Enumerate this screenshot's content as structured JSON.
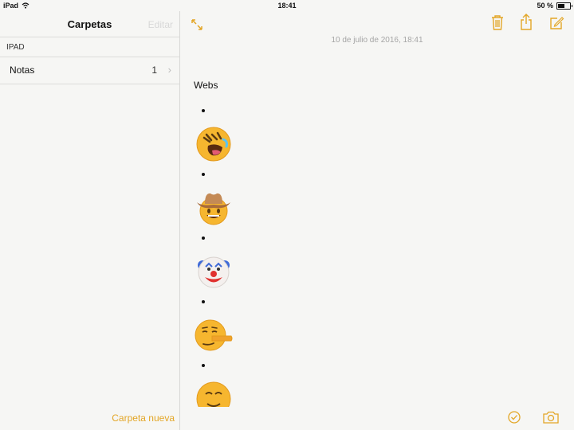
{
  "status": {
    "device": "iPad",
    "time": "18:41",
    "battery": "50 %",
    "battery_level": 0.5
  },
  "sidebar": {
    "title": "Carpetas",
    "edit_label": "Editar",
    "section": "IPAD",
    "folders": [
      {
        "name": "Notas",
        "count": "1"
      }
    ],
    "new_folder_label": "Carpeta nueva"
  },
  "note": {
    "date": "10 de julio de 2016, 18:41",
    "title": "Webs",
    "emojis": [
      "rolling-on-floor-laughing",
      "cowboy-face",
      "clown-face",
      "lying-face",
      "face"
    ]
  },
  "colors": {
    "accent": "#e3a626"
  },
  "icons": [
    "wifi-icon",
    "fullscreen-icon",
    "trash-icon",
    "share-icon",
    "compose-icon",
    "checklist-icon",
    "camera-icon"
  ]
}
